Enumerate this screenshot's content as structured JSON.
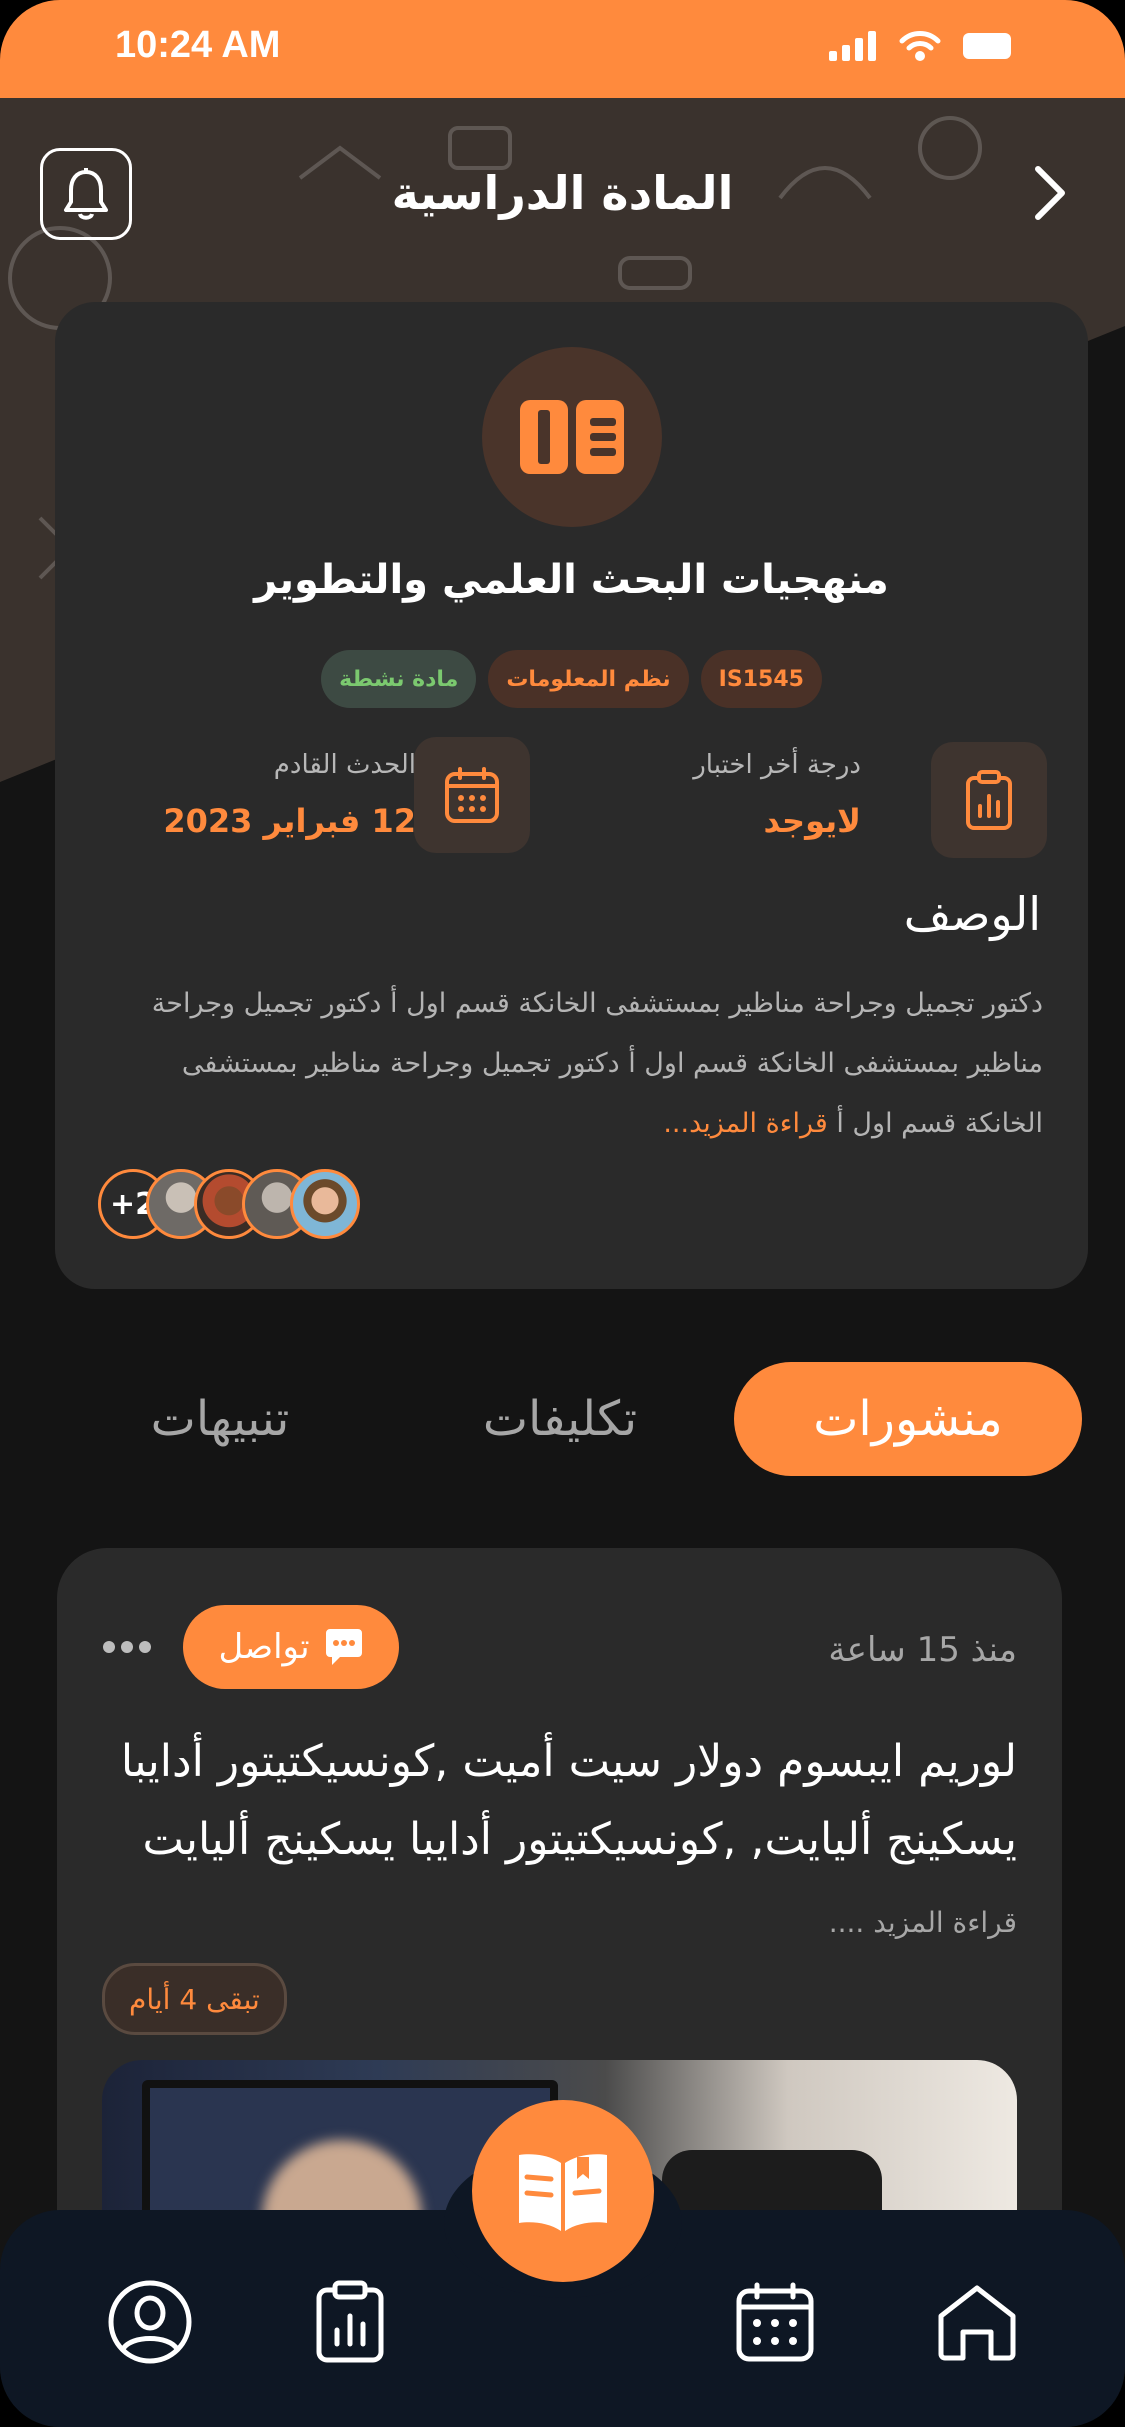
{
  "status": {
    "time": "10:24 AM"
  },
  "header": {
    "title": "المادة الدراسية"
  },
  "course": {
    "title": "منهجيات البحث العلمي والتطوير",
    "chips": [
      "IS1545",
      "نظم المعلومات",
      "مادة نشطة"
    ],
    "last_exam_label": "درجة أخر اختبار",
    "last_exam_value": "لايوجد",
    "next_event_label": "الحدث القادم",
    "next_event_value": "12 فبراير 2023",
    "description_title": "الوصف",
    "description_text": "دكتور تجميل وجراحة مناظير بمستشفى الخانكة قسم اول أ دكتور تجميل وجراحة مناظير بمستشفى الخانكة قسم اول أ دكتور تجميل وجراحة مناظير بمستشفى الخانكة قسم اول أ",
    "read_more": "قراءة المزيد...",
    "members_more": "+2"
  },
  "tabs": [
    {
      "label": "منشورات",
      "active": true
    },
    {
      "label": "تكليفات",
      "active": false
    },
    {
      "label": "تنبيهات",
      "active": false
    }
  ],
  "post": {
    "time": "منذ 15 ساعة",
    "tag": "تواصل",
    "body": "لوريم ايبسوم دولار سيت أميت ,كونسيكتيتور أدايبا يسكينج أليايت, ,كونسيكتيتور أدايبا يسكينج أليايت",
    "more": "قراءة المزيد ....",
    "remaining": "تبقى 4 أيام"
  },
  "colors": {
    "accent": "#FF8A3D",
    "background": "#141414",
    "card": "#2a2a2a",
    "nav": "#0e1724"
  },
  "icons": [
    "bell-icon",
    "chevron-right-icon",
    "book-icon",
    "calendar-icon",
    "clipboard-chart-icon",
    "chat-icon",
    "profile-icon",
    "home-icon"
  ]
}
